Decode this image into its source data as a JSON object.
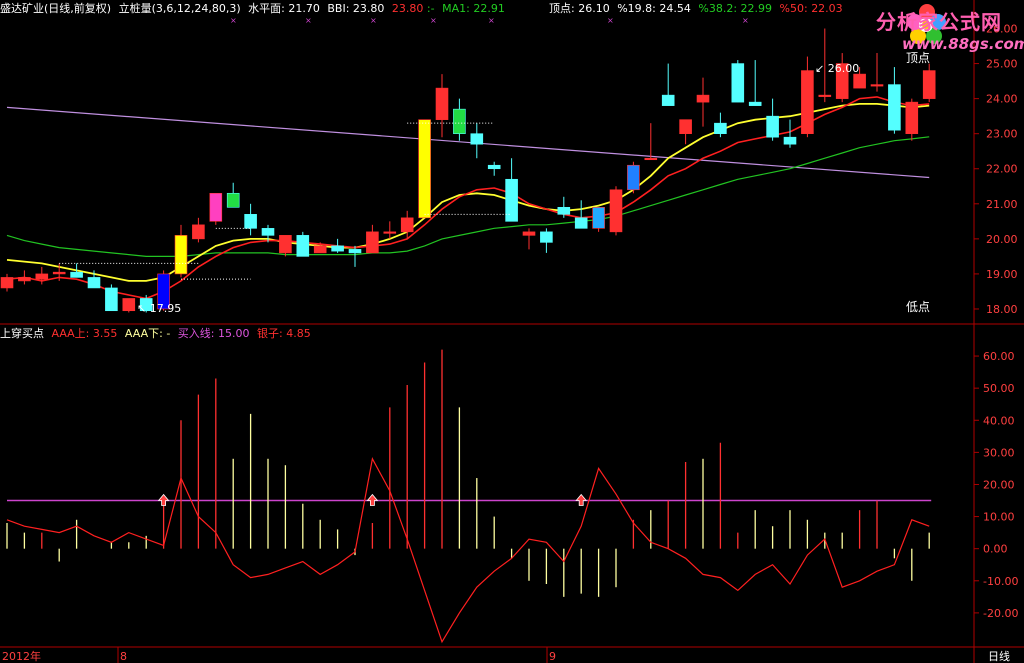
{
  "header": {
    "stock_name": "盛达矿业(日线,前复权)",
    "indicator_name": "立桩量(3,6,12,24,80,3)",
    "level_label": "水平面:",
    "level_value": "21.70",
    "bbi_label": "BBI:",
    "bbi_value": "23.80",
    "price_value": "23.80",
    "price_suffix": ":-",
    "ma1_label": "MA1:",
    "ma1_value": "22.91",
    "top_label": "顶点:",
    "top_value": "26.10",
    "fib1_label": "%19.8:",
    "fib1_value": "24.54",
    "fib2_label": "%38.2:",
    "fib2_value": "22.99",
    "fib3_label": "%50:",
    "fib3_value": "22.03"
  },
  "logo": {
    "text": "分析家公式网",
    "url": "www.88gs.com"
  },
  "colors": {
    "up": "#ff3030",
    "down": "#54ffff",
    "ma_red": "#ff2020",
    "ma_green": "#22c322",
    "ma_yellow": "#ffff30",
    "ma_violet": "#c090e0",
    "axis": "#b00000",
    "purple_line": "#cc44cc",
    "bar_yellow": "#ffffa0"
  },
  "annotations": {
    "top_price": "26.00",
    "low_price": "17.95",
    "top_label": "顶点",
    "low_label": "低点"
  },
  "lower_header": {
    "name": "上穿买点",
    "aaa_up_label": "AAA上:",
    "aaa_up_value": "3.55",
    "aaa_down_label": "AAA下:",
    "aaa_down_value": "-",
    "buy_line_label": "买入线:",
    "buy_line_value": "15.00",
    "silver_label": "银子:",
    "silver_value": "4.85"
  },
  "footer": {
    "bottom_left": "2012年",
    "month1": "8",
    "month2": "9",
    "period": "日线"
  },
  "chart_data": [
    {
      "type": "candlestick",
      "ylim": [
        17.6,
        26.3
      ],
      "yticks": [
        "26.00",
        "25.00",
        "24.00",
        "23.00",
        "22.00",
        "21.00",
        "20.00",
        "19.00",
        "18.00"
      ],
      "ohlc": [
        [
          18.6,
          19.0,
          18.5,
          18.9
        ],
        [
          18.8,
          19.1,
          18.7,
          18.9
        ],
        [
          18.85,
          19.2,
          18.7,
          19.0
        ],
        [
          19.0,
          19.3,
          18.8,
          19.05
        ],
        [
          19.05,
          19.3,
          18.9,
          18.9
        ],
        [
          18.9,
          19.1,
          18.7,
          18.6
        ],
        [
          18.6,
          18.7,
          18.1,
          17.95
        ],
        [
          17.95,
          18.2,
          17.9,
          18.3
        ],
        [
          18.3,
          18.4,
          17.9,
          17.95
        ],
        [
          18.0,
          19.1,
          17.95,
          19.0
        ],
        [
          19.0,
          20.4,
          18.9,
          20.1
        ],
        [
          20.0,
          20.6,
          19.9,
          20.4
        ],
        [
          20.5,
          21.3,
          20.4,
          21.3
        ],
        [
          21.3,
          21.6,
          20.9,
          20.9
        ],
        [
          20.7,
          21.0,
          20.1,
          20.3
        ],
        [
          20.3,
          20.4,
          19.9,
          20.1
        ],
        [
          19.6,
          20.1,
          19.5,
          20.1
        ],
        [
          20.1,
          20.2,
          19.7,
          19.5
        ],
        [
          19.6,
          19.9,
          19.6,
          19.8
        ],
        [
          19.8,
          20.0,
          19.6,
          19.65
        ],
        [
          19.7,
          19.8,
          19.2,
          19.6
        ],
        [
          19.6,
          20.4,
          19.6,
          20.2
        ],
        [
          20.2,
          20.5,
          20.0,
          20.2
        ],
        [
          20.2,
          20.8,
          20.0,
          20.6
        ],
        [
          20.6,
          23.4,
          20.6,
          23.4
        ],
        [
          23.4,
          24.7,
          22.9,
          24.3
        ],
        [
          23.7,
          24.0,
          22.8,
          23.0
        ],
        [
          23.0,
          23.3,
          22.3,
          22.7
        ],
        [
          22.1,
          22.2,
          21.8,
          22.0
        ],
        [
          21.7,
          22.3,
          21.5,
          20.5
        ],
        [
          20.1,
          20.3,
          19.7,
          20.2
        ],
        [
          20.2,
          20.3,
          19.6,
          19.9
        ],
        [
          20.9,
          21.2,
          20.6,
          20.7
        ],
        [
          20.6,
          21.1,
          20.4,
          20.3
        ],
        [
          20.3,
          20.8,
          20.2,
          20.9
        ],
        [
          20.2,
          21.5,
          20.1,
          21.4
        ],
        [
          21.4,
          22.2,
          21.3,
          22.1
        ],
        [
          22.3,
          23.3,
          22.3,
          22.3
        ],
        [
          24.1,
          25.0,
          23.8,
          23.8
        ],
        [
          23.0,
          23.4,
          22.7,
          23.4
        ],
        [
          23.9,
          24.6,
          23.2,
          24.1
        ],
        [
          23.3,
          23.6,
          22.9,
          23.0
        ],
        [
          25.0,
          25.1,
          23.9,
          23.9
        ],
        [
          23.9,
          25.1,
          23.8,
          23.8
        ],
        [
          23.5,
          24.0,
          22.8,
          22.9
        ],
        [
          22.9,
          23.4,
          22.6,
          22.7
        ],
        [
          23.0,
          25.2,
          22.9,
          24.8
        ],
        [
          24.1,
          26.0,
          23.9,
          24.1
        ],
        [
          24.0,
          25.3,
          23.9,
          25.0
        ],
        [
          24.3,
          24.9,
          24.3,
          24.7
        ],
        [
          24.4,
          25.3,
          24.2,
          24.4
        ],
        [
          24.4,
          24.9,
          23.0,
          23.1
        ],
        [
          23.0,
          24.0,
          22.8,
          23.9
        ],
        [
          24.0,
          25.0,
          23.9,
          24.8
        ]
      ],
      "candle_colors": {
        "9": "#0000ff",
        "10": "#ffff00",
        "12": "#ff40c0",
        "13": "#22dd44",
        "24": "#ffff00",
        "26": "#22dd44",
        "34": "#22aaff",
        "36": "#2080ff"
      },
      "ma_red": [
        18.85,
        18.9,
        18.8,
        18.9,
        18.85,
        18.7,
        18.5,
        18.4,
        18.3,
        18.5,
        18.8,
        19.2,
        19.5,
        19.75,
        19.9,
        19.95,
        19.95,
        19.9,
        19.85,
        19.8,
        19.75,
        19.8,
        19.85,
        20.0,
        20.4,
        20.85,
        21.2,
        21.4,
        21.45,
        21.3,
        21.0,
        20.85,
        20.7,
        20.6,
        20.65,
        20.75,
        21.05,
        21.4,
        21.8,
        22.0,
        22.3,
        22.5,
        22.75,
        22.85,
        22.95,
        23.05,
        23.3,
        23.55,
        23.75,
        24.0,
        24.05,
        23.9,
        23.8,
        23.85
      ],
      "ma_green": [
        20.1,
        19.95,
        19.85,
        19.75,
        19.7,
        19.65,
        19.6,
        19.55,
        19.5,
        19.5,
        19.5,
        19.55,
        19.6,
        19.6,
        19.6,
        19.6,
        19.55,
        19.55,
        19.55,
        19.55,
        19.55,
        19.6,
        19.6,
        19.65,
        19.8,
        20.0,
        20.1,
        20.2,
        20.3,
        20.35,
        20.4,
        20.4,
        20.45,
        20.5,
        20.55,
        20.65,
        20.8,
        20.95,
        21.1,
        21.25,
        21.4,
        21.55,
        21.7,
        21.8,
        21.9,
        22.0,
        22.15,
        22.3,
        22.45,
        22.6,
        22.7,
        22.8,
        22.85,
        22.91
      ],
      "ma_yellow": [
        19.4,
        19.35,
        19.3,
        19.2,
        19.1,
        19.0,
        18.9,
        18.8,
        18.8,
        18.9,
        19.2,
        19.5,
        19.8,
        19.95,
        20.0,
        20.0,
        19.9,
        19.85,
        19.8,
        19.75,
        19.75,
        19.85,
        20.0,
        20.2,
        20.6,
        21.05,
        21.25,
        21.3,
        21.25,
        21.1,
        20.95,
        20.85,
        20.8,
        20.85,
        20.95,
        21.1,
        21.4,
        21.8,
        22.3,
        22.6,
        22.9,
        23.1,
        23.3,
        23.4,
        23.45,
        23.5,
        23.6,
        23.7,
        23.8,
        23.85,
        23.85,
        23.8,
        23.75,
        23.8
      ],
      "ma_violet_start": 23.75,
      "ma_violet_end": 21.75
    },
    {
      "type": "bar",
      "ylim": [
        -30,
        65
      ],
      "yticks": [
        "60.00",
        "50.00",
        "40.00",
        "30.00",
        "20.00",
        "10.00",
        "0.00",
        "-10.00",
        "-20.00"
      ],
      "buy_line": 15.0,
      "red_bars": [
        [
          2,
          5
        ],
        [
          9,
          14
        ],
        [
          10,
          40
        ],
        [
          11,
          48
        ],
        [
          12,
          53
        ],
        [
          21,
          8
        ],
        [
          22,
          44
        ],
        [
          23,
          51
        ],
        [
          24,
          58
        ],
        [
          25,
          62
        ],
        [
          36,
          9
        ],
        [
          38,
          15
        ],
        [
          39,
          27
        ],
        [
          41,
          33
        ],
        [
          42,
          5
        ],
        [
          49,
          12
        ],
        [
          50,
          15
        ]
      ],
      "yellow_bars": [
        [
          0,
          8
        ],
        [
          1,
          5
        ],
        [
          3,
          -4
        ],
        [
          4,
          9
        ],
        [
          6,
          2
        ],
        [
          7,
          2
        ],
        [
          8,
          4
        ],
        [
          13,
          28
        ],
        [
          14,
          42
        ],
        [
          15,
          28
        ],
        [
          16,
          26
        ],
        [
          17,
          14
        ],
        [
          18,
          9
        ],
        [
          19,
          6
        ],
        [
          20,
          -2
        ],
        [
          26,
          44
        ],
        [
          27,
          22
        ],
        [
          28,
          10
        ],
        [
          29,
          -3
        ],
        [
          30,
          -10
        ],
        [
          31,
          -11
        ],
        [
          32,
          -15
        ],
        [
          33,
          -14
        ],
        [
          34,
          -15
        ],
        [
          35,
          -12
        ],
        [
          37,
          12
        ],
        [
          40,
          28
        ],
        [
          43,
          12
        ],
        [
          44,
          7
        ],
        [
          45,
          12
        ],
        [
          46,
          9
        ],
        [
          47,
          5
        ],
        [
          48,
          5
        ],
        [
          51,
          -3
        ],
        [
          52,
          -10
        ],
        [
          53,
          5
        ]
      ],
      "line": [
        9,
        7,
        6,
        5,
        7,
        4,
        2,
        5,
        3,
        1,
        22,
        10,
        5,
        -5,
        -9,
        -8,
        -6,
        -4,
        -8,
        -5,
        -1,
        28,
        18,
        3,
        -13,
        -29,
        -20,
        -12,
        -7,
        -3,
        3,
        2,
        -4,
        7,
        25,
        17,
        8,
        2,
        0,
        -3,
        -8,
        -9,
        -13,
        -8,
        -5,
        -11,
        -2,
        3,
        -12,
        -10,
        -7,
        -5,
        9,
        7
      ],
      "arrows": [
        9,
        21,
        33
      ]
    }
  ]
}
